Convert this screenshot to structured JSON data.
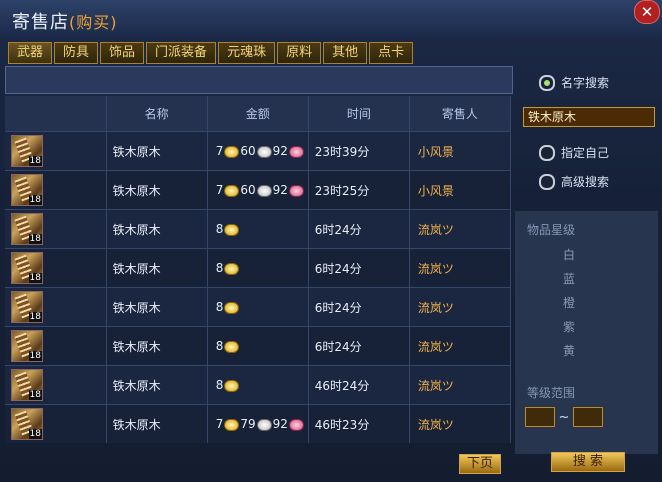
{
  "title": {
    "main": "寄售店",
    "sub": "(购买)"
  },
  "tabs": [
    "武器",
    "防具",
    "饰品",
    "门派装备",
    "元魂珠",
    "原料",
    "其他",
    "点卡"
  ],
  "table": {
    "headers": {
      "name": "名称",
      "price": "金额",
      "time": "时间",
      "seller": "寄售人"
    },
    "rows": [
      {
        "name": "铁木原木",
        "gold": "7",
        "silver": "60",
        "copper": "92",
        "time": "23时39分",
        "seller": "小风景",
        "badge": "18"
      },
      {
        "name": "铁木原木",
        "gold": "7",
        "silver": "60",
        "copper": "92",
        "time": "23时25分",
        "seller": "小风景",
        "badge": "18"
      },
      {
        "name": "铁木原木",
        "gold": "8",
        "silver": "",
        "copper": "",
        "time": "6时24分",
        "seller": "流岚ツ",
        "badge": "18"
      },
      {
        "name": "铁木原木",
        "gold": "8",
        "silver": "",
        "copper": "",
        "time": "6时24分",
        "seller": "流岚ツ",
        "badge": "18"
      },
      {
        "name": "铁木原木",
        "gold": "8",
        "silver": "",
        "copper": "",
        "time": "6时24分",
        "seller": "流岚ツ",
        "badge": "18"
      },
      {
        "name": "铁木原木",
        "gold": "8",
        "silver": "",
        "copper": "",
        "time": "6时24分",
        "seller": "流岚ツ",
        "badge": "18"
      },
      {
        "name": "铁木原木",
        "gold": "8",
        "silver": "",
        "copper": "",
        "time": "46时24分",
        "seller": "流岚ツ",
        "badge": "18"
      },
      {
        "name": "铁木原木",
        "gold": "7",
        "silver": "79",
        "copper": "92",
        "time": "46时23分",
        "seller": "流岚ツ",
        "badge": "18"
      }
    ]
  },
  "search_panel": {
    "name_search": "名字搜索",
    "name_value": "铁木原木",
    "specify_self": "指定自己",
    "advanced": "高级搜索",
    "star_label": "物品星级",
    "qualities": [
      "白",
      "蓝",
      "橙",
      "紫",
      "黄"
    ],
    "level_range": "等级范围",
    "search_button": "搜 索"
  },
  "pager": {
    "next": "下页"
  },
  "icons": {
    "close": "close-icon",
    "coin_gold": "gold-coin-icon",
    "coin_silver": "silver-coin-icon",
    "coin_copper": "copper-coin-icon",
    "item": "wood-log-icon"
  }
}
